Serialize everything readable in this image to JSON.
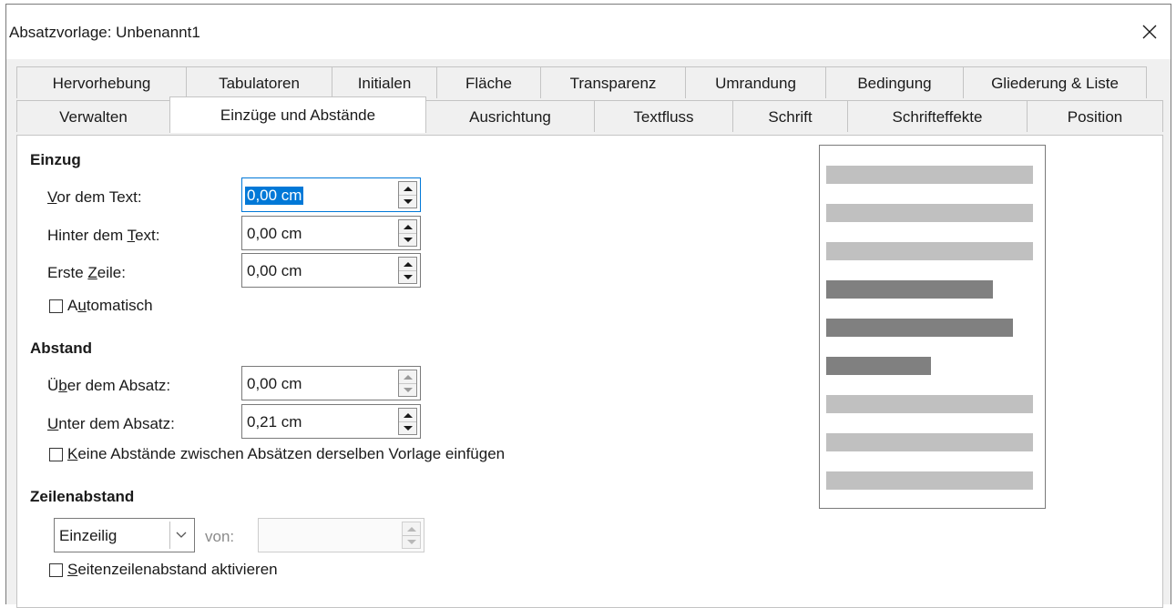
{
  "window": {
    "title": "Absatzvorlage: Unbenannt1",
    "close_icon": "close-icon"
  },
  "tabs_row1": [
    "Hervorhebung",
    "Tabulatoren",
    "Initialen",
    "Fläche",
    "Transparenz",
    "Umrandung",
    "Bedingung",
    "Gliederung & Liste"
  ],
  "tabs_row2": [
    "Verwalten",
    "Einzüge und Abstände",
    "Ausrichtung",
    "Textfluss",
    "Schrift",
    "Schrifteffekte",
    "Position"
  ],
  "active_tab": "Einzüge und Abstände",
  "einzug": {
    "heading": "Einzug",
    "vor_label_mn": "V",
    "vor_label_rest": "or dem Text:",
    "vor_value": "0,00 cm",
    "hinter_label_pre": "Hinter dem ",
    "hinter_label_mn": "T",
    "hinter_label_rest": "ext:",
    "hinter_value": "0,00 cm",
    "erste_label_pre": "Erste ",
    "erste_label_mn": "Z",
    "erste_label_rest": "eile:",
    "erste_value": "0,00 cm",
    "auto_label_pre": "A",
    "auto_label_mn": "u",
    "auto_label_rest": "tomatisch"
  },
  "abstand": {
    "heading": "Abstand",
    "ueber_label_pre": "Ü",
    "ueber_label_mn": "b",
    "ueber_label_rest": "er dem Absatz:",
    "ueber_value": "0,00 cm",
    "unter_label_mn": "U",
    "unter_label_rest": "nter dem Absatz:",
    "unter_value": "0,21 cm",
    "keine_label_mn": "K",
    "keine_label_rest": "eine Abstände zwischen Absätzen derselben Vorlage einfügen"
  },
  "zeilenabstand": {
    "heading": "Zeilenabstand",
    "mode": "Einzeilig",
    "von_label": "von:",
    "von_value": "",
    "seiten_label_mn": "S",
    "seiten_label_rest": "eitenzeilenabstand aktivieren"
  },
  "colors": {
    "accent": "#0078d7",
    "preview_light": "#c0c0c0",
    "preview_dark": "#808080"
  }
}
